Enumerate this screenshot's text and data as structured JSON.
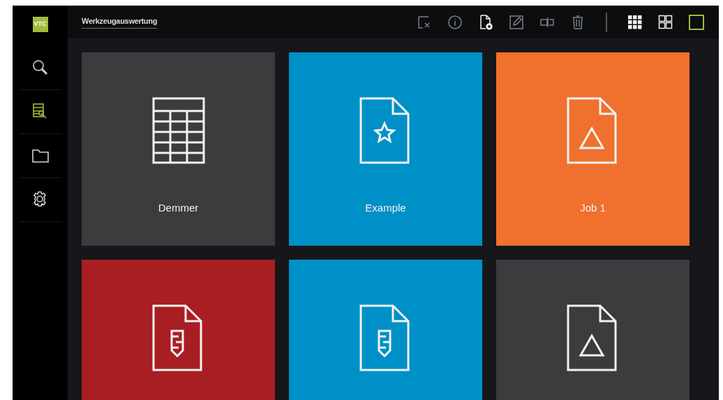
{
  "logo": "VTC",
  "sidebar": {
    "items": [
      {
        "kind": "search",
        "selected": false
      },
      {
        "kind": "tool-table",
        "selected": true
      },
      {
        "kind": "folder",
        "selected": false
      },
      {
        "kind": "settings",
        "selected": false
      }
    ]
  },
  "header": {
    "title": "Werkzeugauswertung"
  },
  "toolbar": [
    {
      "kind": "clear-selection",
      "disabled": true
    },
    {
      "kind": "info",
      "disabled": true
    },
    {
      "kind": "new-file",
      "disabled": false
    },
    {
      "kind": "edit",
      "disabled": true
    },
    {
      "kind": "rename",
      "disabled": true
    },
    {
      "kind": "delete",
      "disabled": true
    }
  ],
  "view_modes": [
    {
      "kind": "small-grid",
      "selected": false
    },
    {
      "kind": "medium-grid",
      "selected": false
    },
    {
      "kind": "large-grid",
      "selected": true
    }
  ],
  "tiles": [
    {
      "kind": "table",
      "label": "Demmer",
      "color": "#3b3c3e"
    },
    {
      "kind": "star-file",
      "label": "Example",
      "color": "#0090c8"
    },
    {
      "kind": "triangle-file",
      "label": "Job 1",
      "color": "#f0702d"
    },
    {
      "kind": "tool-file",
      "color": "#a91e22"
    },
    {
      "kind": "tool-file",
      "color": "#0090c8"
    },
    {
      "kind": "triangle-file",
      "color": "#3b3c3e"
    }
  ]
}
